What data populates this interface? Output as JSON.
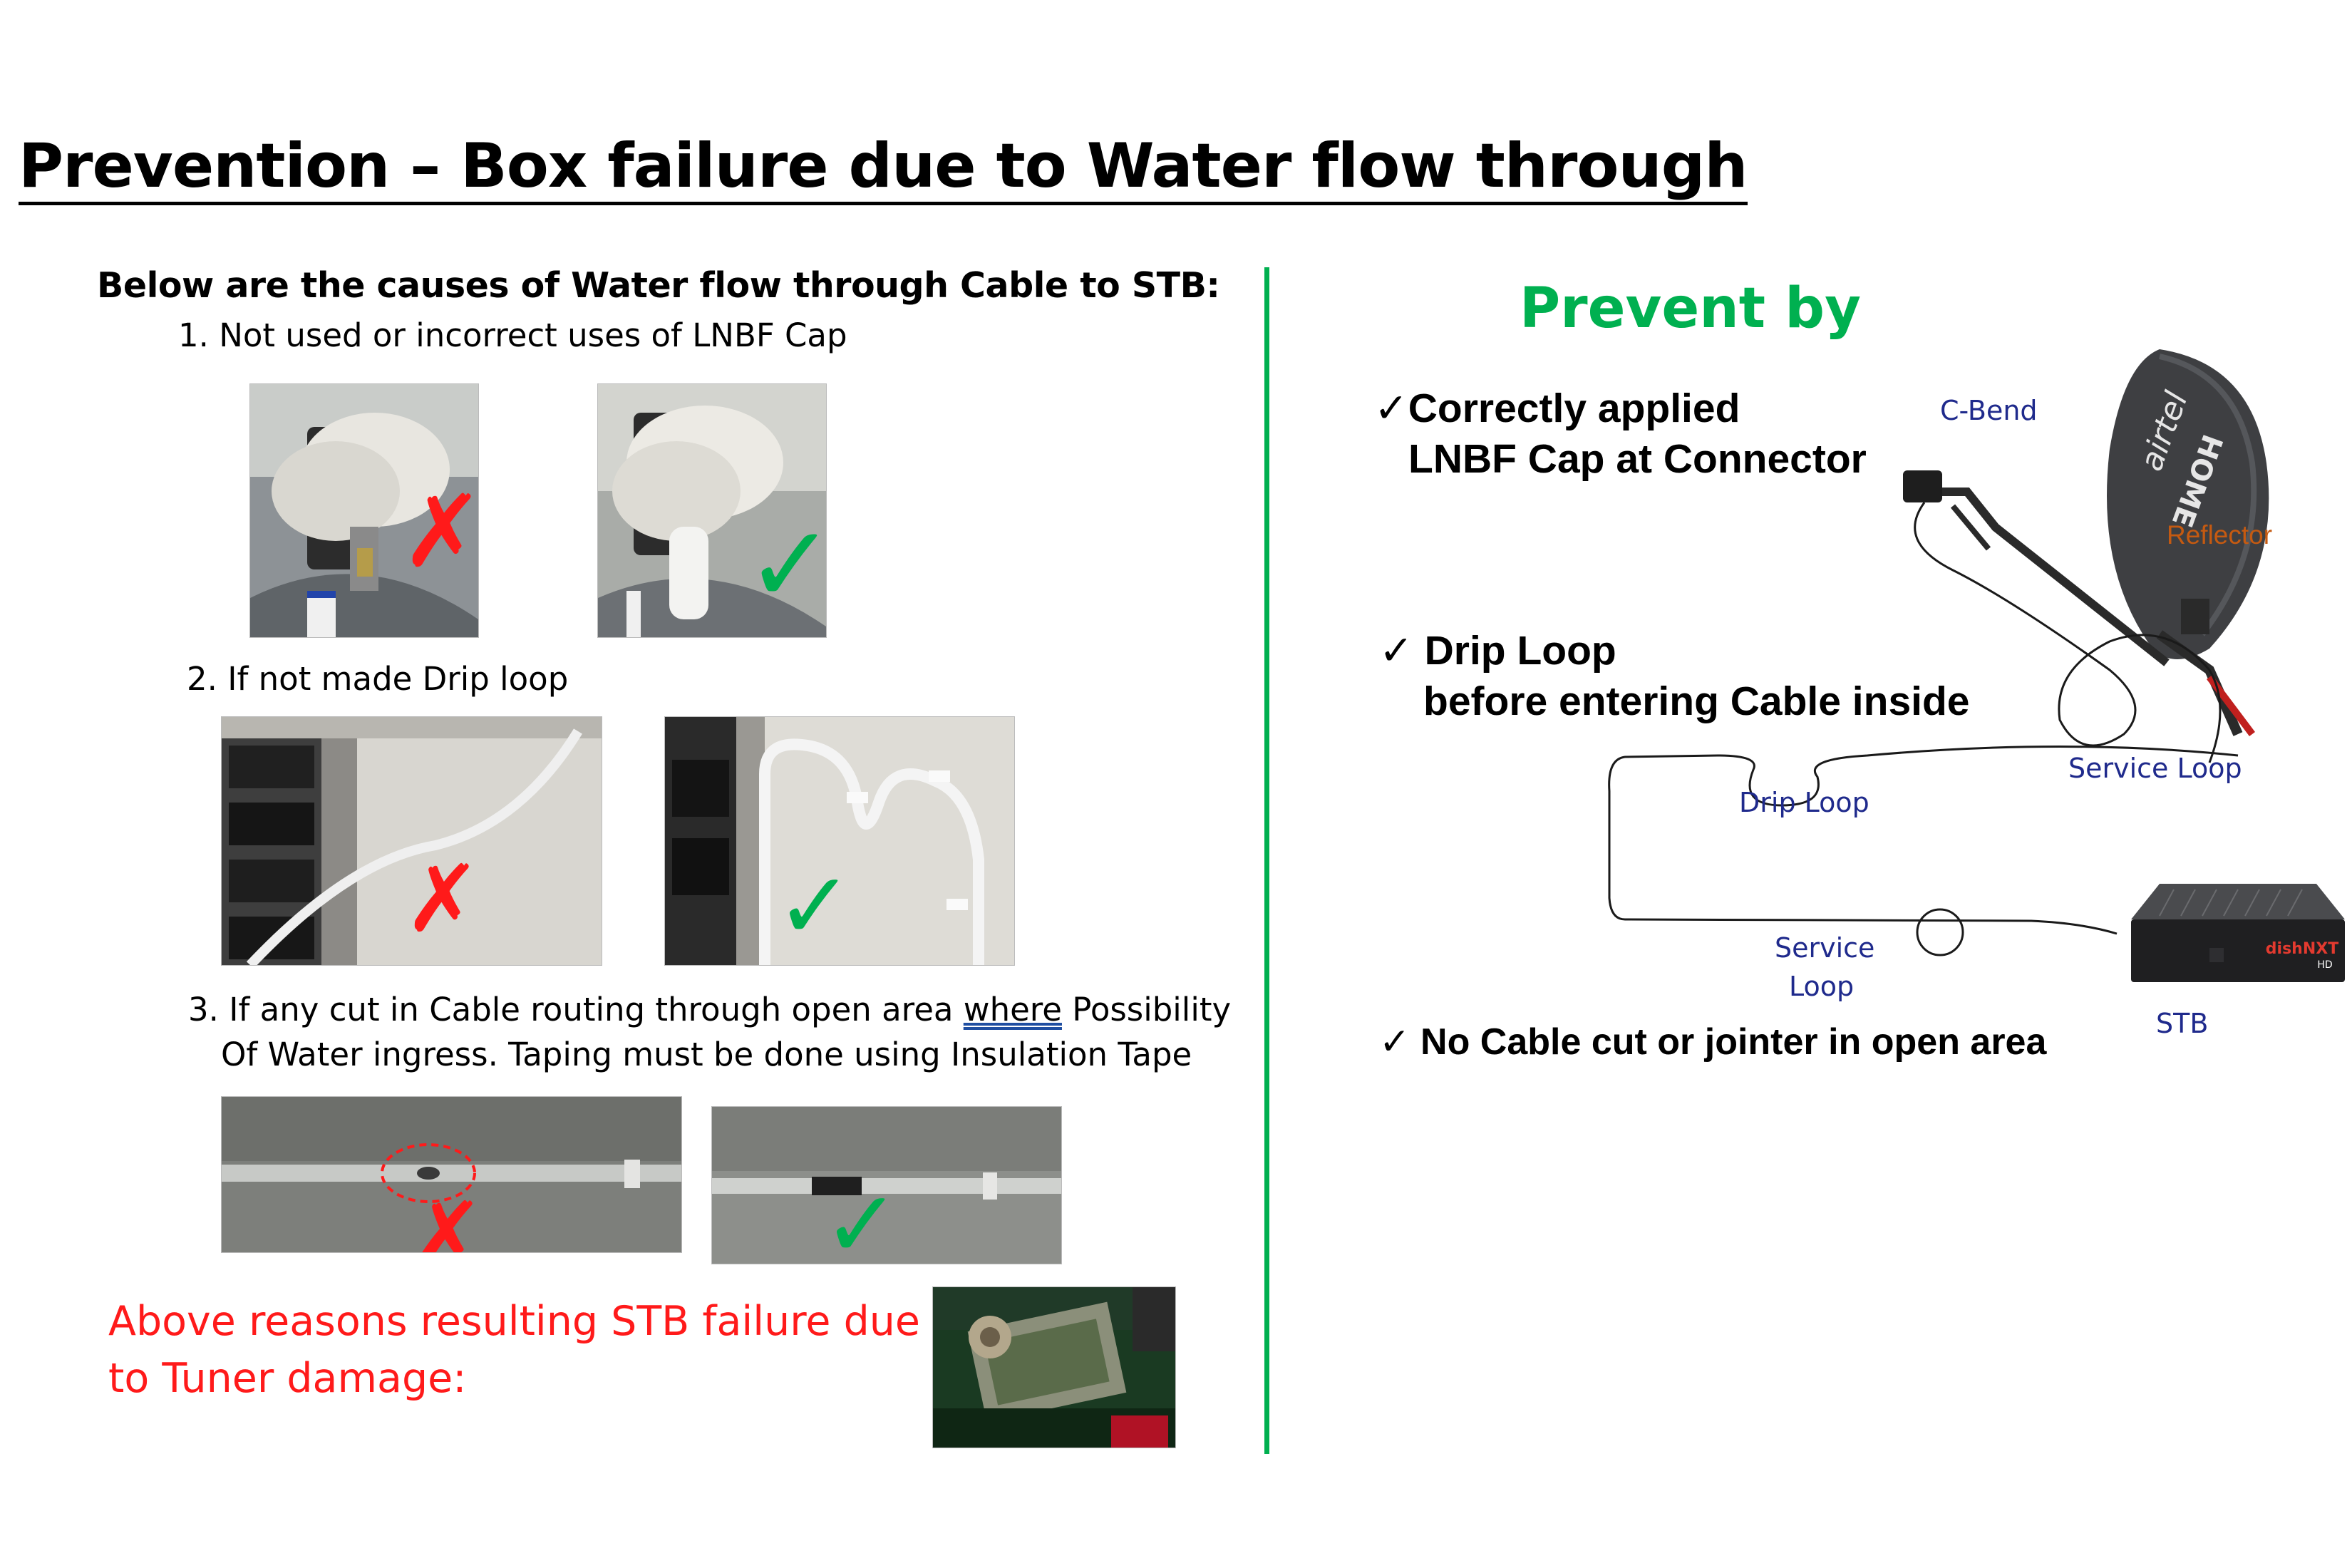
{
  "title": {
    "emphasis": "Prevention",
    "rest": " – Box failure due to Water flow through "
  },
  "left": {
    "heading": "Below are the causes of Water flow through Cable to STB:",
    "item1": "1. Not used or incorrect uses of LNBF Cap",
    "item2": "2. If not made Drip loop",
    "item3_line1_pre": "3. If any cut in Cable routing through open area ",
    "item3_line1_where": "where",
    "item3_line1_post": " Possibility",
    "item3_line2": "Of Water ingress. Taping must be done using Insulation Tape",
    "note_line1": "Above reasons resulting STB failure due",
    "note_line2": "to Tuner damage:",
    "mark_wrong": "✗",
    "mark_right": "✓"
  },
  "right": {
    "heading": "Prevent by",
    "check1_line1": "Correctly applied",
    "check1_line2": "LNBF Cap at Connector",
    "check2_line1": "Drip Loop",
    "check2_line2": "before entering Cable inside",
    "check3": "No Cable cut or jointer in open area",
    "check_mark": "✓",
    "labels": {
      "c_bend": "C-Bend",
      "reflector": "Reflector",
      "service_loop_top": "Service Loop",
      "drip_loop": "Drip Loop",
      "service": "Service",
      "loop": "Loop",
      "stb": "STB"
    },
    "dish_brand_line1": "airtel",
    "dish_brand_line2": "HOME",
    "stb_brand": "dishNXT",
    "stb_brand_badge": "HD"
  },
  "colors": {
    "accent_green": "#00b050",
    "warning_red": "#ff1a1a",
    "label_blue": "#1f2a8c",
    "label_orange": "#c55a11"
  }
}
